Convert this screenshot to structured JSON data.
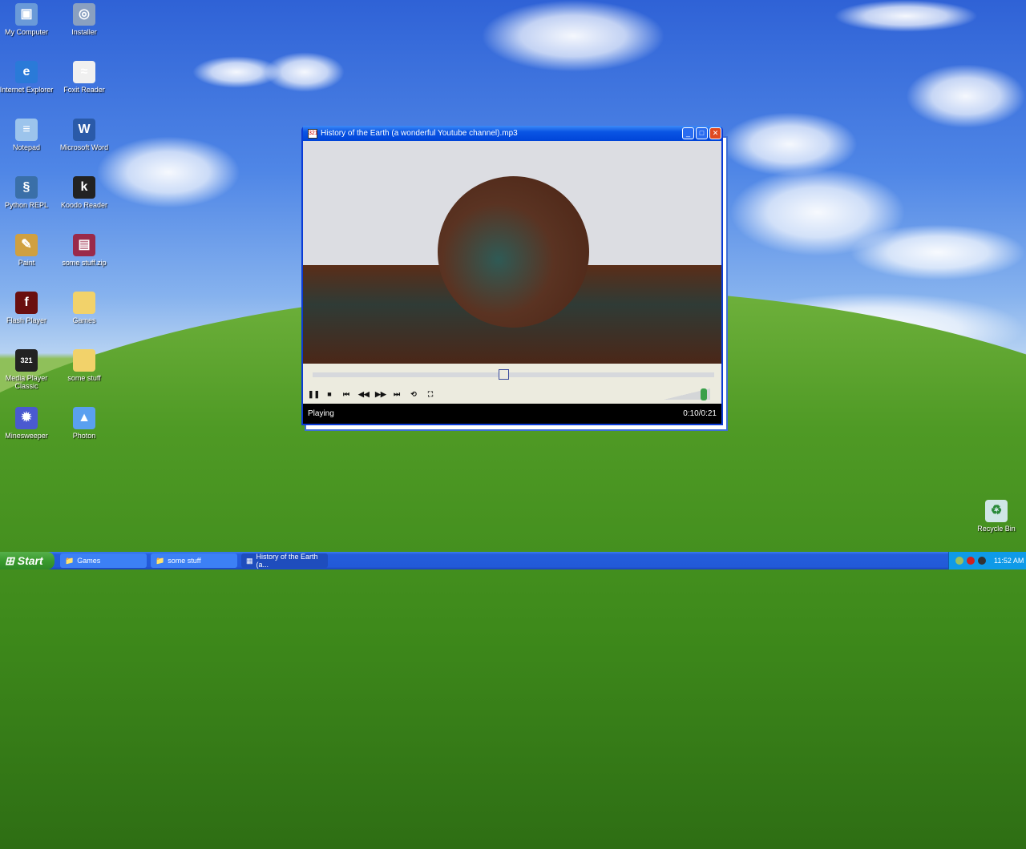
{
  "desktop": {
    "icons": [
      {
        "label": "My Computer",
        "icon": "computer-icon",
        "color": "#6a9ad8",
        "glyph": "▣"
      },
      {
        "label": "Installer",
        "icon": "installer-icon",
        "color": "#8aa0c0",
        "glyph": "◎"
      },
      {
        "label": "Internet Explorer",
        "icon": "ie-icon",
        "color": "#2a7ad8",
        "glyph": "e"
      },
      {
        "label": "Foxit Reader",
        "icon": "foxit-icon",
        "color": "#f0f0f0",
        "glyph": "≈"
      },
      {
        "label": "Notepad",
        "icon": "notepad-icon",
        "color": "#9cc4ec",
        "glyph": "≡"
      },
      {
        "label": "Microsoft Word",
        "icon": "word-icon",
        "color": "#2a5aa8",
        "glyph": "W"
      },
      {
        "label": "Python REPL",
        "icon": "python-icon",
        "color": "#3a6fa8",
        "glyph": "§"
      },
      {
        "label": "Koodo Reader",
        "icon": "koodo-icon",
        "color": "#222",
        "glyph": "k"
      },
      {
        "label": "Paint",
        "icon": "paint-icon",
        "color": "#d0a040",
        "glyph": "✎"
      },
      {
        "label": "some stuff.zip",
        "icon": "winrar-icon",
        "color": "#9a2a4a",
        "glyph": "▤"
      },
      {
        "label": "Flash Player",
        "icon": "flash-icon",
        "color": "#6a0f0f",
        "glyph": "f"
      },
      {
        "label": "Games",
        "icon": "folder-icon",
        "color": "#f2d26a",
        "glyph": ""
      },
      {
        "label": "Media Player Classic",
        "icon": "mpc-icon",
        "color": "#222",
        "glyph": "321"
      },
      {
        "label": "some stuff",
        "icon": "folder-icon",
        "color": "#f2d26a",
        "glyph": ""
      },
      {
        "label": "Minesweeper",
        "icon": "minesweeper-icon",
        "color": "#4a5ad0",
        "glyph": "✹"
      },
      {
        "label": "Photon",
        "icon": "photon-icon",
        "color": "#5aa0f0",
        "glyph": "▲"
      }
    ],
    "recycle_bin": "Recycle Bin"
  },
  "player": {
    "title": "History of the Earth (a wonderful Youtube channel).mp3",
    "status": "Playing",
    "time": "0:10/0:21",
    "progress": 0.476,
    "volume": 0.9,
    "buttons": [
      "pause",
      "stop",
      "previous",
      "rewind",
      "fast-forward",
      "next",
      "repeat",
      "fullscreen"
    ]
  },
  "taskbar": {
    "start": "Start",
    "tasks": [
      "Games",
      "some stuff",
      "History of the Earth (a..."
    ],
    "clock": "11:52 AM"
  }
}
